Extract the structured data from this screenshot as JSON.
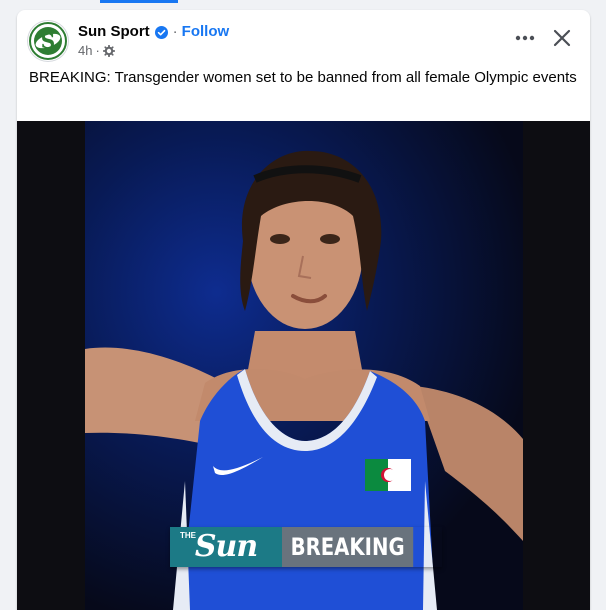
{
  "post": {
    "page_name": "Sun Sport",
    "follow_label": "Follow",
    "separator": "·",
    "time_ago": "4h",
    "text": "BREAKING: Transgender women set to be banned from all female Olympic events"
  },
  "icons": {
    "verified": "verified-badge-icon",
    "audience": "gear-icon",
    "more": "more-options-icon",
    "close": "close-icon",
    "avatar_logo": "sun-sport-logo"
  },
  "media": {
    "banner_the": "THE",
    "banner_brand": "Sun",
    "banner_label": "BREAKING",
    "alt": "Boxer in blue vest with Algerian flag, arms outstretched"
  },
  "colors": {
    "accent": "#1877f2",
    "banner_brand_bg": "#1c7a86",
    "banner_label_bg": "#69737d"
  }
}
